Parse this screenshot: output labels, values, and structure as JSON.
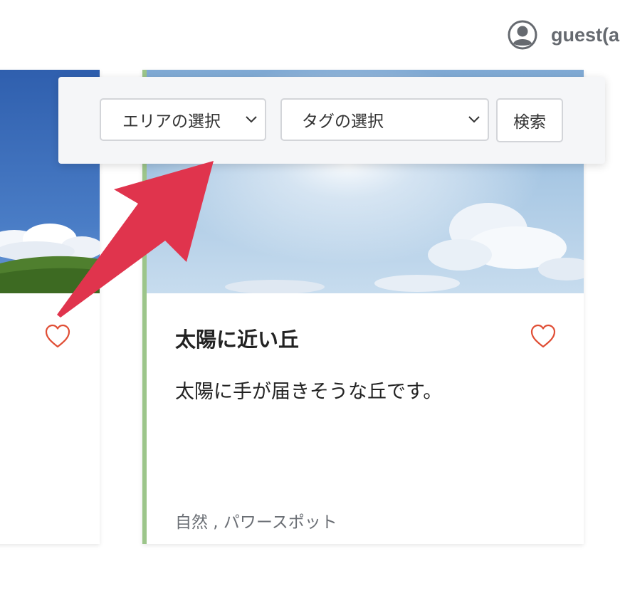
{
  "header": {
    "user_name": "guest(a"
  },
  "search": {
    "area_placeholder": "エリアの選択",
    "tag_placeholder": "タグの選択",
    "search_label": "検索"
  },
  "cards": [
    {
      "title": "",
      "description": "",
      "tags": ""
    },
    {
      "title": "太陽に近い丘",
      "description": "太陽に手が届きそうな丘です。",
      "tags": "自然 , パワースポット"
    }
  ],
  "colors": {
    "accent_border": "#9cc58a",
    "heart": "#e04e35",
    "arrow": "#e0344d",
    "user_text": "#666a70"
  },
  "icons": {
    "user": "user-circle-icon",
    "favorite": "heart-icon",
    "dropdown": "chevron-down-icon",
    "annotation": "arrow-icon"
  }
}
